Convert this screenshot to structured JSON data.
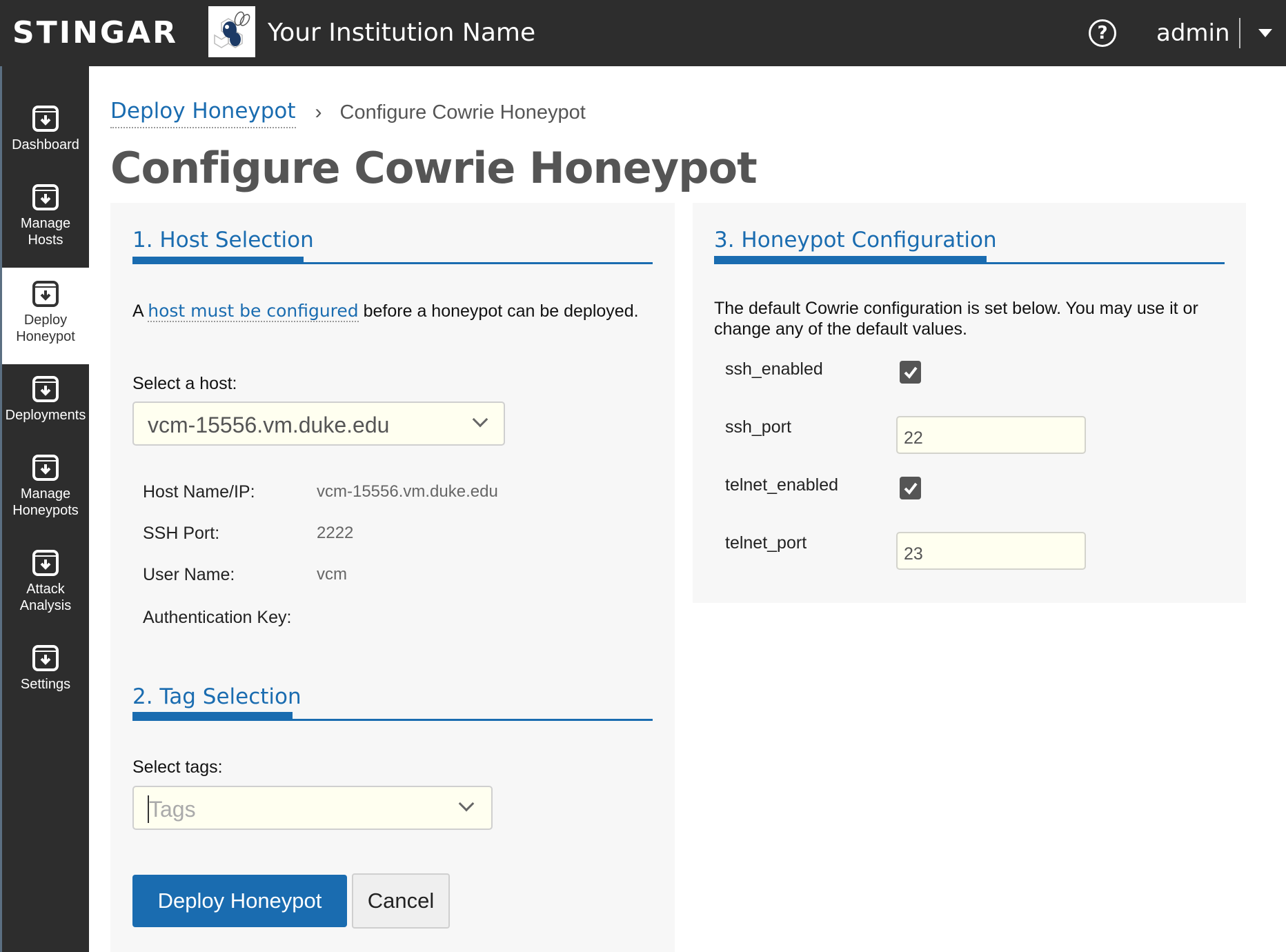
{
  "header": {
    "brand": "STINGAR",
    "institution": "Your Institution Name",
    "help_icon": "question-circle-icon",
    "username": "admin"
  },
  "sidebar": {
    "items": [
      {
        "label": "Dashboard",
        "icon": "archive-download-icon",
        "active": false
      },
      {
        "label": "Manage\nHosts",
        "icon": "archive-download-icon",
        "active": false
      },
      {
        "label": "Deploy\nHoneypot",
        "icon": "archive-download-icon",
        "active": true
      },
      {
        "label": "Deployments",
        "icon": "archive-download-icon",
        "active": false
      },
      {
        "label": "Manage\nHoneypots",
        "icon": "archive-download-icon",
        "active": false
      },
      {
        "label": "Attack\nAnalysis",
        "icon": "archive-download-icon",
        "active": false
      },
      {
        "label": "Settings",
        "icon": "archive-download-icon",
        "active": false
      }
    ]
  },
  "breadcrumb": {
    "parent": "Deploy Honeypot",
    "separator": ">",
    "current": "Configure Cowrie Honeypot"
  },
  "page_title": "Configure Cowrie Honeypot",
  "host_selection": {
    "heading": "1. Host Selection",
    "notice_prefix": "A",
    "notice_link": "host must be configured",
    "notice_suffix": "before a honeypot can be deployed.",
    "select_label": "Select a host:",
    "selected_host": "vcm-15556.vm.duke.edu",
    "details": [
      {
        "label": "Host Name/IP:",
        "value": "vcm-15556.vm.duke.edu"
      },
      {
        "label": "SSH Port:",
        "value": "2222"
      },
      {
        "label": "User Name:",
        "value": "vcm"
      },
      {
        "label": "Authentication Key:",
        "value": ""
      }
    ]
  },
  "tag_selection": {
    "heading": "2. Tag Selection",
    "select_label": "Select tags:",
    "placeholder": "Tags"
  },
  "actions": {
    "deploy_label": "Deploy Honeypot",
    "cancel_label": "Cancel"
  },
  "honeypot_config": {
    "heading": "3. Honeypot Configuration",
    "description": "The default Cowrie configuration is set below. You may use it or change any of the default values.",
    "fields": [
      {
        "name": "ssh_enabled",
        "type": "checkbox",
        "checked": true
      },
      {
        "name": "ssh_port",
        "type": "text",
        "value": "22"
      },
      {
        "name": "telnet_enabled",
        "type": "checkbox",
        "checked": true
      },
      {
        "name": "telnet_port",
        "type": "text",
        "value": "23"
      }
    ]
  },
  "colors": {
    "accent": "#1a6cb0",
    "header_bg": "#2d2d2d",
    "panel_bg": "#f7f7f7",
    "input_bg": "#fffff0"
  }
}
